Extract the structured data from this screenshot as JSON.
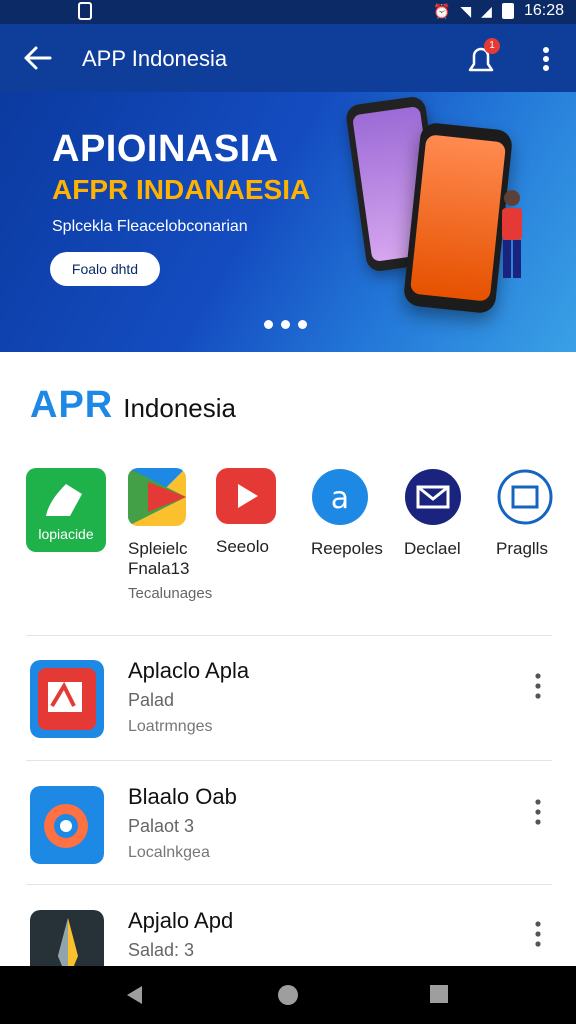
{
  "status_bar": {
    "time": "16:28"
  },
  "app_bar": {
    "title": "APP Indonesia",
    "notification_count": "1"
  },
  "banner": {
    "headline": "APIOINASIA",
    "headline2": "AFPR INDANAESIA",
    "subtitle": "Splcekla Fleacelobconarian",
    "cta_label": "Foalo dhtd"
  },
  "brand": {
    "apr": "APR",
    "indonesia": "Indonesia"
  },
  "featured_apps": [
    {
      "label": "lopiacide",
      "name": "Spleielc",
      "name2": "Fnala13",
      "meta": "Tecalunages",
      "icon": "google-play-like-icon",
      "color": "#1fb24a"
    },
    {
      "name": "Seeolo",
      "icon": "youtube-like-icon",
      "color": "#e53935"
    },
    {
      "name": "Reepoles",
      "icon": "at-sign-icon",
      "color": "#1e88e5"
    },
    {
      "name": "Declael",
      "icon": "mail-icon",
      "color": "#1a237e"
    },
    {
      "name": "Praglls",
      "icon": "window-icon",
      "color": "#1565c0"
    }
  ],
  "list": [
    {
      "title": "Aplaclo Apla",
      "subtitle": "Palad",
      "meta": "Loatrmnges",
      "icon": "red-tile-icon"
    },
    {
      "title": "Blaalo Oab",
      "subtitle": "Palaot 3",
      "meta": "Localnkgea",
      "icon": "orange-blue-tile-icon"
    },
    {
      "title": "Apjalo Apd",
      "subtitle": "Salad: 3",
      "meta": "",
      "icon": "dark-star-tile-icon"
    }
  ]
}
